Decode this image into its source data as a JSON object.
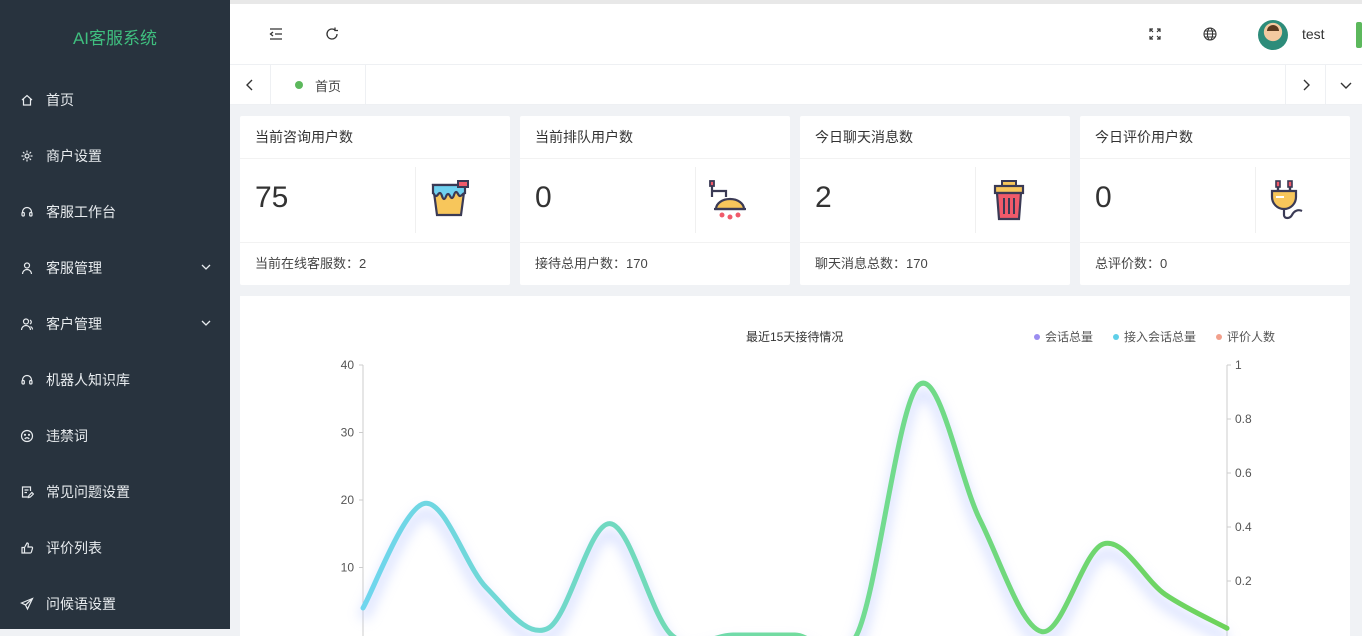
{
  "app": {
    "title": "AI客服系统"
  },
  "sidebar": {
    "items": [
      {
        "label": "首页",
        "icon": "home-icon",
        "has_arrow": false
      },
      {
        "label": "商户设置",
        "icon": "gear-icon",
        "has_arrow": false
      },
      {
        "label": "客服工作台",
        "icon": "headset-icon",
        "has_arrow": false
      },
      {
        "label": "客服管理",
        "icon": "user-icon",
        "has_arrow": true
      },
      {
        "label": "客户管理",
        "icon": "users-icon",
        "has_arrow": true
      },
      {
        "label": "机器人知识库",
        "icon": "headset-icon",
        "has_arrow": false
      },
      {
        "label": "违禁词",
        "icon": "sad-face-icon",
        "has_arrow": false
      },
      {
        "label": "常见问题设置",
        "icon": "edit-doc-icon",
        "has_arrow": false
      },
      {
        "label": "评价列表",
        "icon": "thumbs-up-icon",
        "has_arrow": false
      },
      {
        "label": "问候语设置",
        "icon": "send-icon",
        "has_arrow": false
      }
    ]
  },
  "header": {
    "username": "test"
  },
  "tabs": {
    "home_label": "首页"
  },
  "cards": [
    {
      "title": "当前咨询用户数",
      "value": "75",
      "footer": "当前在线客服数：2",
      "icon": "paint-bucket-icon"
    },
    {
      "title": "当前排队用户数",
      "value": "0",
      "footer": "接待总用户数：170",
      "icon": "shower-icon"
    },
    {
      "title": "今日聊天消息数",
      "value": "2",
      "footer": "聊天消息总数：170",
      "icon": "trash-can-icon"
    },
    {
      "title": "今日评价用户数",
      "value": "0",
      "footer": "总评价数：0",
      "icon": "plug-icon"
    }
  ],
  "chart_data": {
    "type": "line",
    "title": "最近15天接待情况",
    "legend_position": "top-right",
    "series": [
      {
        "name": "会话总量",
        "color": "#9b8df0"
      },
      {
        "name": "接入会话总量",
        "color": "#5fcfe8"
      },
      {
        "name": "评价人数",
        "color": "#f2a08c"
      }
    ],
    "y_left": {
      "ticks": [
        "40",
        "30",
        "20",
        "10"
      ],
      "range": [
        0,
        40
      ]
    },
    "y_right": {
      "ticks": [
        "1",
        "0.8",
        "0.6",
        "0.4",
        "0.2"
      ],
      "range": [
        0,
        1
      ]
    },
    "visible_curve": {
      "x_index": [
        0,
        1,
        2,
        3,
        4,
        5,
        6,
        7,
        8,
        9,
        10,
        11,
        12,
        13,
        14
      ],
      "values": [
        4,
        19.5,
        7,
        1,
        16.5,
        0,
        0,
        0,
        0,
        37,
        17,
        0.5,
        13.5,
        6,
        1
      ]
    }
  }
}
